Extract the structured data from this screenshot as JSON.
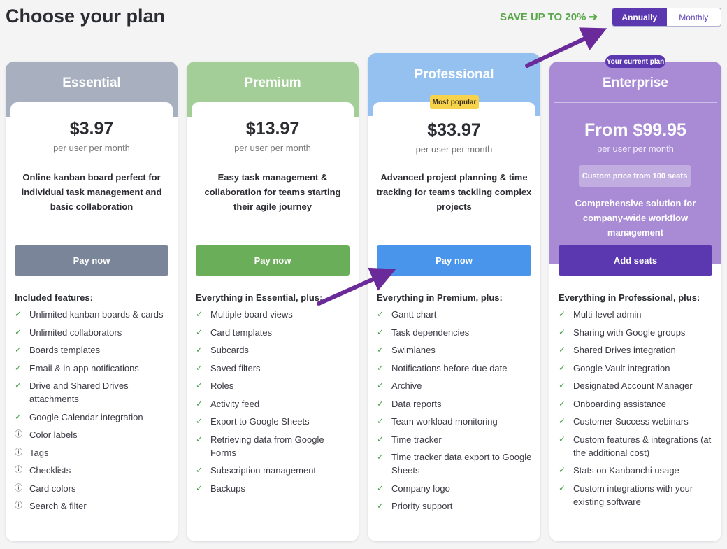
{
  "header": {
    "title": "Choose your plan",
    "save_note": "SAVE UP TO 20% ➔",
    "billing": {
      "annually": "Annually",
      "monthly": "Monthly",
      "selected": "Annually"
    }
  },
  "colors": {
    "essential": "#a8b0c0",
    "premium": "#a4ce98",
    "professional": "#94c1ef",
    "enterprise": "#a88ad5",
    "accent": "#5b38b0",
    "save_green": "#5aa64a"
  },
  "plans": {
    "essential": {
      "name": "Essential",
      "price": "$3.97",
      "per": "per user per month",
      "desc": "Online kanban board perfect for individual task management and basic collaboration",
      "cta": "Pay now",
      "features_title": "Included features:",
      "features": [
        {
          "text": "Unlimited kanban boards & cards",
          "icon": "check-icon"
        },
        {
          "text": "Unlimited collaborators",
          "icon": "check-icon"
        },
        {
          "text": "Boards templates",
          "icon": "check-icon"
        },
        {
          "text": "Email & in-app notifications",
          "icon": "check-icon"
        },
        {
          "text": "Drive and Shared Drives attachments",
          "icon": "check-icon"
        },
        {
          "text": "Google Calendar integration",
          "icon": "check-icon"
        },
        {
          "text": "Color labels",
          "icon": "info-icon"
        },
        {
          "text": "Tags",
          "icon": "info-icon"
        },
        {
          "text": "Checklists",
          "icon": "info-icon"
        },
        {
          "text": "Card colors",
          "icon": "info-icon"
        },
        {
          "text": "Search & filter",
          "icon": "info-icon"
        }
      ]
    },
    "premium": {
      "name": "Premium",
      "price": "$13.97",
      "per": "per user per month",
      "desc": "Easy task management & collaboration for teams starting their agile journey",
      "cta": "Pay now",
      "features_title": "Everything in Essential, plus:",
      "features": [
        {
          "text": "Multiple board views",
          "icon": "check-icon"
        },
        {
          "text": "Card templates",
          "icon": "check-icon"
        },
        {
          "text": "Subcards",
          "icon": "check-icon"
        },
        {
          "text": "Saved filters",
          "icon": "check-icon"
        },
        {
          "text": "Roles",
          "icon": "check-icon"
        },
        {
          "text": "Activity feed",
          "icon": "check-icon"
        },
        {
          "text": "Export to Google Sheets",
          "icon": "check-icon"
        },
        {
          "text": "Retrieving data from Google Forms",
          "icon": "check-icon"
        },
        {
          "text": "Subscription management",
          "icon": "check-icon"
        },
        {
          "text": "Backups",
          "icon": "check-icon"
        }
      ]
    },
    "professional": {
      "name": "Professional",
      "badge": "Most popular",
      "price": "$33.97",
      "per": "per user per month",
      "desc": "Advanced project planning & time tracking for teams tackling complex projects",
      "cta": "Pay now",
      "features_title": "Everything in Premium, plus:",
      "features": [
        {
          "text": "Gantt chart",
          "icon": "check-icon"
        },
        {
          "text": "Task dependencies",
          "icon": "check-icon"
        },
        {
          "text": "Swimlanes",
          "icon": "check-icon"
        },
        {
          "text": "Notifications before due date",
          "icon": "check-icon"
        },
        {
          "text": "Archive",
          "icon": "check-icon"
        },
        {
          "text": "Data reports",
          "icon": "check-icon"
        },
        {
          "text": "Team workload monitoring",
          "icon": "check-icon"
        },
        {
          "text": "Time tracker",
          "icon": "check-icon"
        },
        {
          "text": "Time tracker data export to Google Sheets",
          "icon": "check-icon"
        },
        {
          "text": "Company logo",
          "icon": "check-icon"
        },
        {
          "text": "Priority support",
          "icon": "check-icon"
        }
      ]
    },
    "enterprise": {
      "name": "Enterprise",
      "badge": "Your current plan",
      "price": "From $99.95",
      "per": "per user per month",
      "custom_price": "Custom price from 100 seats",
      "desc": "Comprehensive solution for company-wide workflow management",
      "cta": "Add seats",
      "features_title": "Everything in Professional, plus:",
      "features": [
        {
          "text": "Multi-level admin",
          "icon": "check-icon"
        },
        {
          "text": "Sharing with Google groups",
          "icon": "check-icon"
        },
        {
          "text": "Shared Drives integration",
          "icon": "check-icon"
        },
        {
          "text": "Google Vault integration",
          "icon": "check-icon"
        },
        {
          "text": "Designated Account Manager",
          "icon": "check-icon"
        },
        {
          "text": "Onboarding assistance",
          "icon": "check-icon"
        },
        {
          "text": "Customer Success webinars",
          "icon": "check-icon"
        },
        {
          "text": "Custom features & integrations (at the additional cost)",
          "icon": "check-icon"
        },
        {
          "text": "Stats on Kanbanchi usage",
          "icon": "check-icon"
        },
        {
          "text": "Custom integrations with your existing software",
          "icon": "check-icon"
        }
      ]
    }
  }
}
